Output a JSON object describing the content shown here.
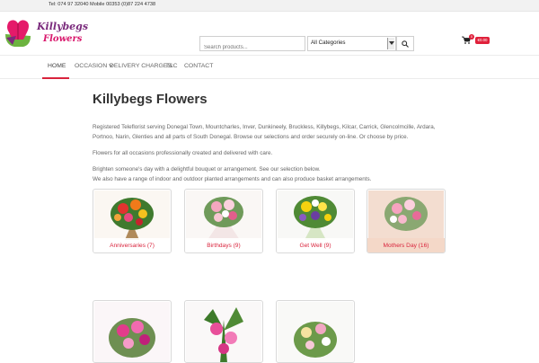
{
  "topbar": {
    "phone": "Tel: 074 97 32040 Mobile 00353 (0)87 224 4738"
  },
  "brand": {
    "line1": "Killybegs",
    "line2": "Flowers"
  },
  "search": {
    "placeholder": "Search products...",
    "category": "All Categories"
  },
  "cart": {
    "count": "0",
    "total": "€0.00"
  },
  "nav": [
    {
      "label": "Home",
      "active": true
    },
    {
      "label": "Occasion",
      "has_dropdown": true
    },
    {
      "label": "Delivery Charges"
    },
    {
      "label": "T&C"
    },
    {
      "label": "Contact"
    }
  ],
  "page": {
    "title": "Killybegs Flowers",
    "para1": "Registered Teleflorist serving Donegal Town, Mountcharles, Inver, Dunkineely, Bruckless, Killybegs, Kilcar, Carrick, Glencolmcille, Ardara, Portnoo, Narin, Glenties and all parts of South Donegal. Browse our selections and order securely on-line.  Or choose by price.",
    "para2": "Flowers for all occasions professionally created and delivered with care.",
    "para3a": "Brighten someone's day with a delightful bouquet or arrangement. See our selection below.",
    "para3b": "We also have a range of indoor and outdoor planted arrangements and can also produce basket arrangements."
  },
  "categories": [
    {
      "label": "Anniversaries  (7)"
    },
    {
      "label": "Birthdays  (9)"
    },
    {
      "label": "Get Well  (9)"
    },
    {
      "label": "Mothers Day  (16)"
    },
    {
      "label": ""
    },
    {
      "label": ""
    },
    {
      "label": ""
    }
  ],
  "colors": {
    "accent": "#d9233c",
    "brand_purple": "#7a2a7c",
    "brand_pink": "#d9176c",
    "leaf_green": "#6cb33f"
  }
}
